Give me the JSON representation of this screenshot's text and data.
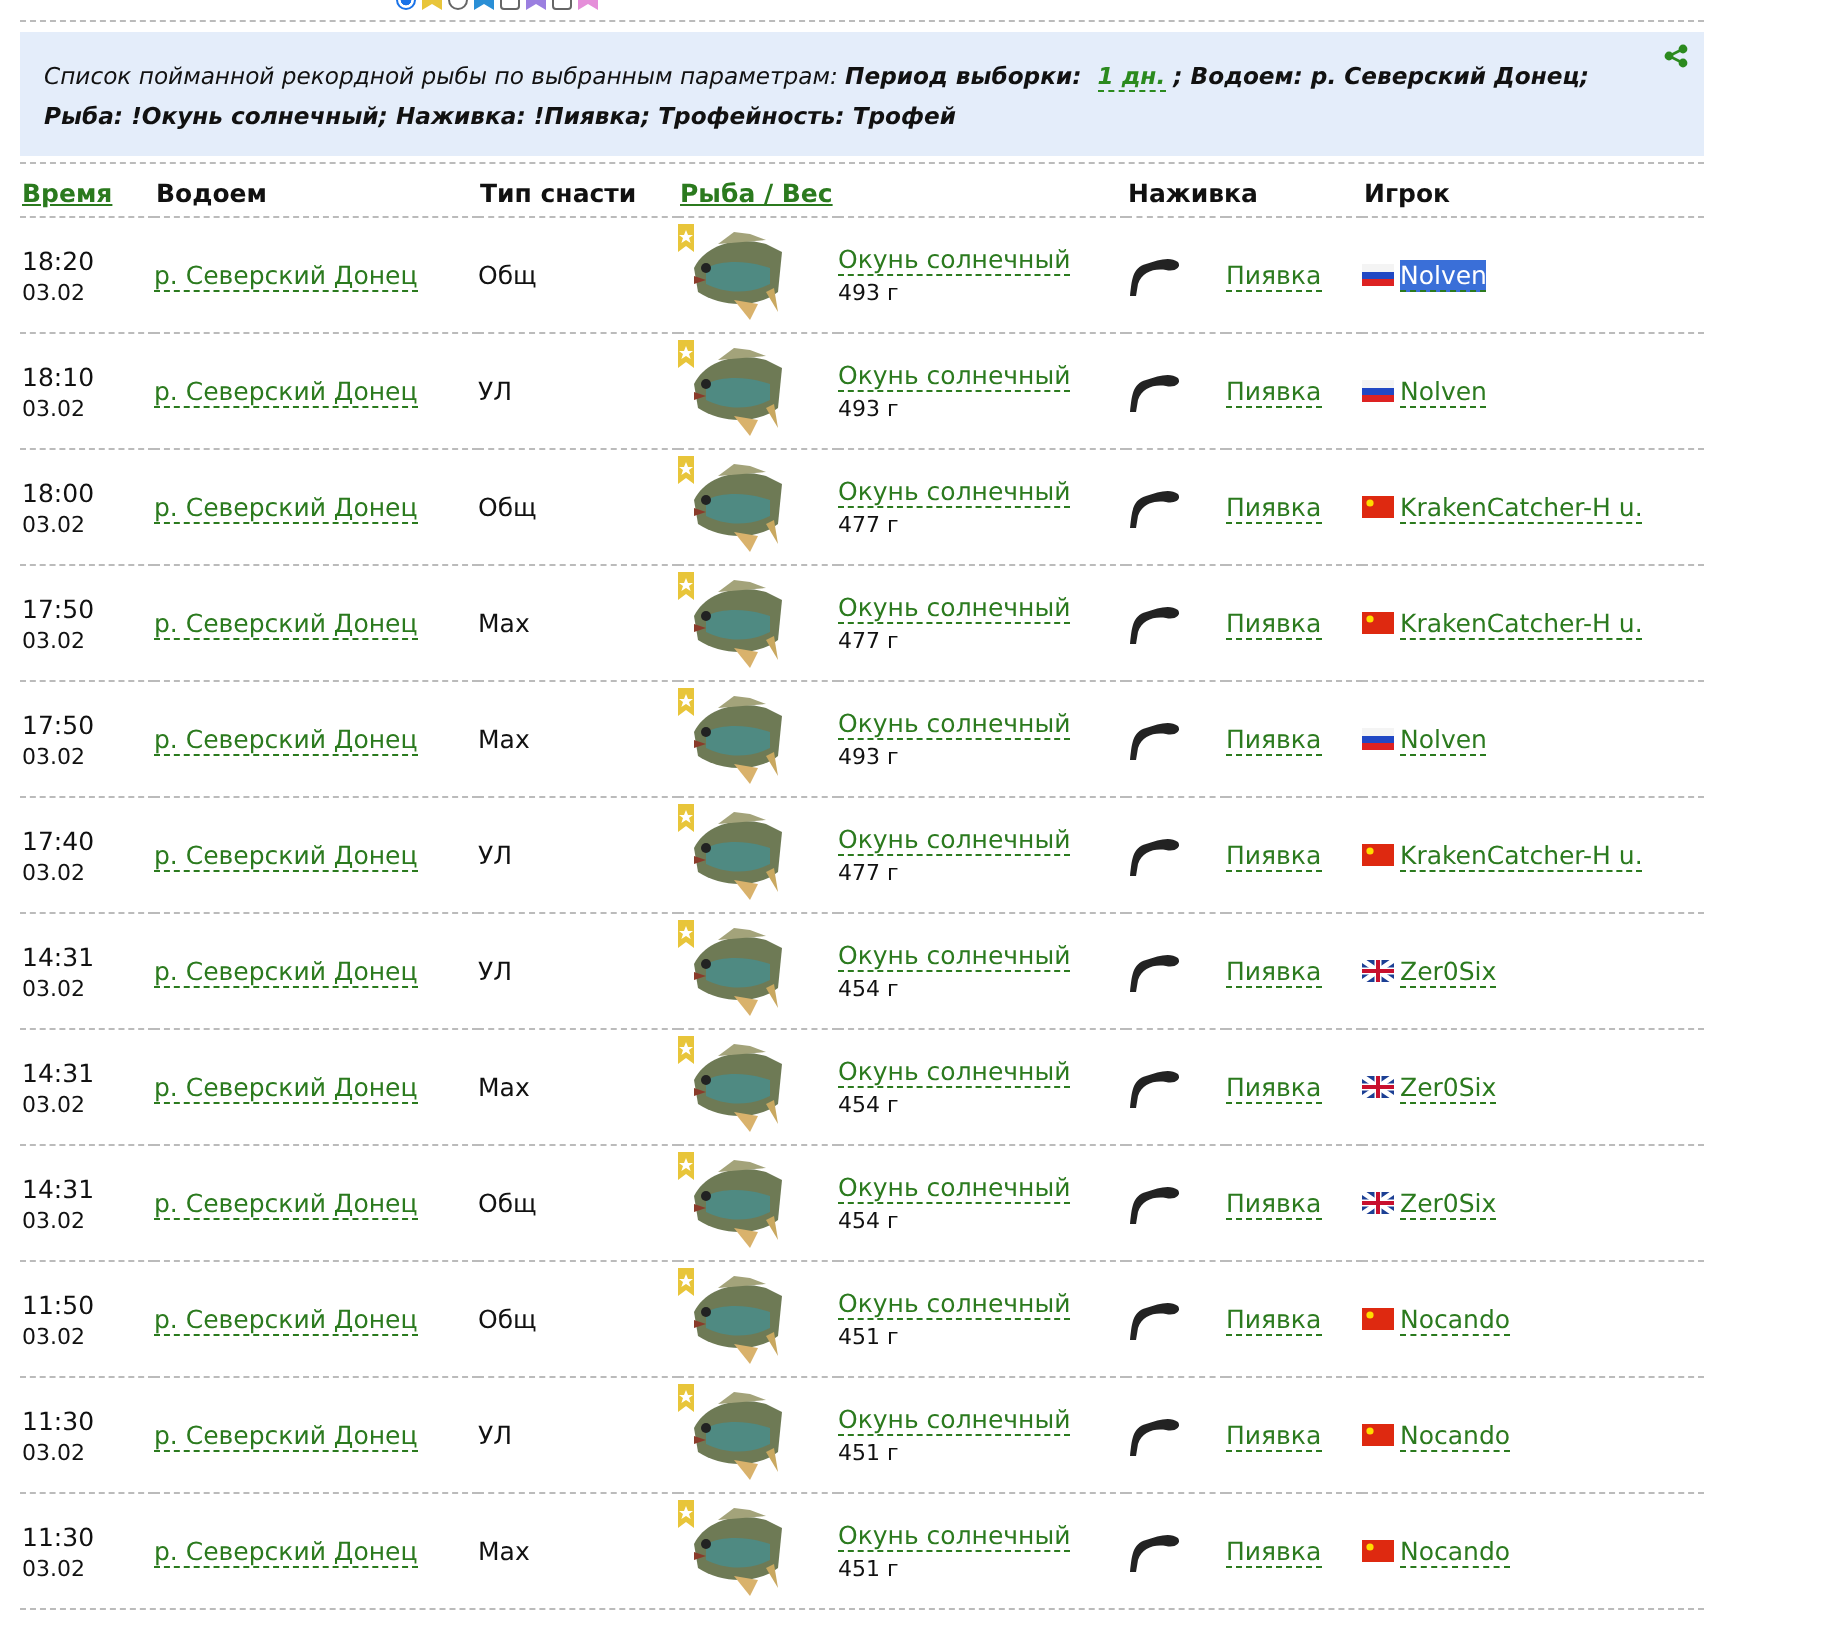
{
  "filters": [
    {
      "kind": "radio",
      "selected": true,
      "color": "#e8c53a"
    },
    {
      "kind": "radio",
      "selected": false,
      "color": "#2a8fd6"
    },
    {
      "kind": "checkbox",
      "selected": false,
      "color": "#9b7fe0"
    },
    {
      "kind": "checkbox",
      "selected": false,
      "color": "#e58fd9"
    }
  ],
  "info": {
    "text": "Список пойманной рекордной рыбы по выбранным параметрам: **Период выборки:**",
    "period_value": "1 дн.",
    "rest": "; Водоем: р. Северский Донец; Рыба: !Окунь солнечный; Наживка: !Пиявка; Трофейность: Трофей"
  },
  "columns": [
    {
      "label": "Время",
      "sortable": true
    },
    {
      "label": "Водоем",
      "sortable": false
    },
    {
      "label": "Тип снасти",
      "sortable": false
    },
    {
      "label": "Рыба / Вес",
      "sortable": true
    },
    {
      "label": "Наживка",
      "sortable": false
    },
    {
      "label": "Игрок",
      "sortable": false
    }
  ],
  "rows": [
    {
      "time": "18:20",
      "date": "03.02",
      "water": "р. Северский Донец",
      "tackle": "Общ",
      "fish": "Окунь солнечный",
      "weight": "493 г",
      "bait": "Пиявка",
      "flag": {
        "kind": "ru"
      },
      "player": "Nolven",
      "highlighted": true
    },
    {
      "time": "18:10",
      "date": "03.02",
      "water": "р. Северский Донец",
      "tackle": "УЛ",
      "fish": "Окунь солнечный",
      "weight": "493 г",
      "bait": "Пиявка",
      "flag": {
        "kind": "ru"
      },
      "player": "Nolven",
      "highlighted": false
    },
    {
      "time": "18:00",
      "date": "03.02",
      "water": "р. Северский Донец",
      "tackle": "Общ",
      "fish": "Окунь солнечный",
      "weight": "477 г",
      "bait": "Пиявка",
      "flag": {
        "kind": "cn"
      },
      "player": "KrakenCatcher-H u.",
      "highlighted": false
    },
    {
      "time": "17:50",
      "date": "03.02",
      "water": "р. Северский Донец",
      "tackle": "Мах",
      "fish": "Окунь солнечный",
      "weight": "477 г",
      "bait": "Пиявка",
      "flag": {
        "kind": "cn"
      },
      "player": "KrakenCatcher-H u.",
      "highlighted": false
    },
    {
      "time": "17:50",
      "date": "03.02",
      "water": "р. Северский Донец",
      "tackle": "Мах",
      "fish": "Окунь солнечный",
      "weight": "493 г",
      "bait": "Пиявка",
      "flag": {
        "kind": "ru"
      },
      "player": "Nolven",
      "highlighted": false
    },
    {
      "time": "17:40",
      "date": "03.02",
      "water": "р. Северский Донец",
      "tackle": "УЛ",
      "fish": "Окунь солнечный",
      "weight": "477 г",
      "bait": "Пиявка",
      "flag": {
        "kind": "cn"
      },
      "player": "KrakenCatcher-H u.",
      "highlighted": false
    },
    {
      "time": "14:31",
      "date": "03.02",
      "water": "р. Северский Донец",
      "tackle": "УЛ",
      "fish": "Окунь солнечный",
      "weight": "454 г",
      "bait": "Пиявка",
      "flag": {
        "kind": "gb"
      },
      "player": "Zer0Six",
      "highlighted": false
    },
    {
      "time": "14:31",
      "date": "03.02",
      "water": "р. Северский Донец",
      "tackle": "Мах",
      "fish": "Окунь солнечный",
      "weight": "454 г",
      "bait": "Пиявка",
      "flag": {
        "kind": "gb"
      },
      "player": "Zer0Six",
      "highlighted": false
    },
    {
      "time": "14:31",
      "date": "03.02",
      "water": "р. Северский Донец",
      "tackle": "Общ",
      "fish": "Окунь солнечный",
      "weight": "454 г",
      "bait": "Пиявка",
      "flag": {
        "kind": "gb"
      },
      "player": "Zer0Six",
      "highlighted": false
    },
    {
      "time": "11:50",
      "date": "03.02",
      "water": "р. Северский Донец",
      "tackle": "Общ",
      "fish": "Окунь солнечный",
      "weight": "451 г",
      "bait": "Пиявка",
      "flag": {
        "kind": "cn"
      },
      "player": "Nocando",
      "highlighted": false
    },
    {
      "time": "11:30",
      "date": "03.02",
      "water": "р. Северский Донец",
      "tackle": "УЛ",
      "fish": "Окунь солнечный",
      "weight": "451 г",
      "bait": "Пиявка",
      "flag": {
        "kind": "cn"
      },
      "player": "Nocando",
      "highlighted": false
    },
    {
      "time": "11:30",
      "date": "03.02",
      "water": "р. Северский Донец",
      "tackle": "Мах",
      "fish": "Окунь солнечный",
      "weight": "451 г",
      "bait": "Пиявка",
      "flag": {
        "kind": "cn"
      },
      "player": "Nocando",
      "highlighted": false
    }
  ]
}
